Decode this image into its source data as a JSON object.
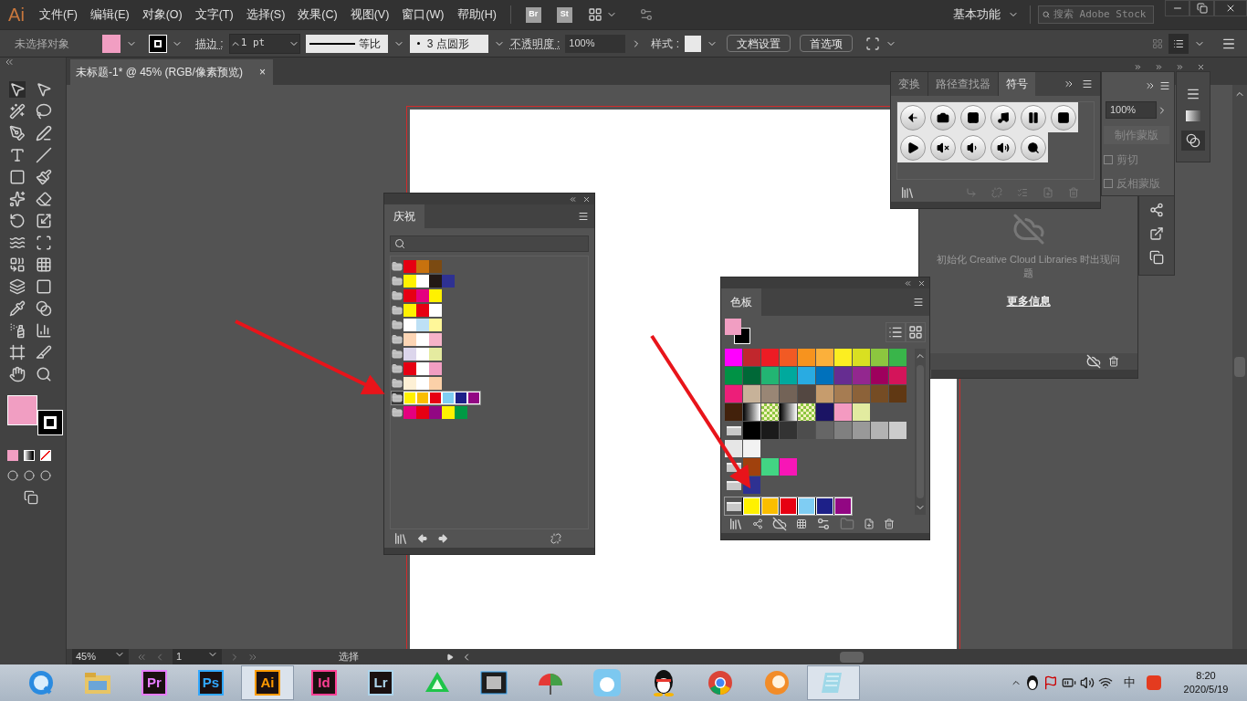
{
  "app": {
    "logo": "Ai",
    "menus": [
      "文件(F)",
      "编辑(E)",
      "对象(O)",
      "文字(T)",
      "选择(S)",
      "效果(C)",
      "视图(V)",
      "窗口(W)",
      "帮助(H)"
    ],
    "bridges": [
      "Br",
      "St"
    ],
    "workspace": "基本功能",
    "search": {
      "placeholder": "搜索 Adobe Stock"
    }
  },
  "control_bar": {
    "selection": "未选择对象",
    "fill": {
      "color": "#f19ec2"
    },
    "stroke_label": "描边 :",
    "stroke_weight": "1 pt",
    "stroke_profile": "等比",
    "brush": "3 点圆形",
    "opacity_label": "不透明度 :",
    "opacity": "100%",
    "style_label": "样式 :",
    "buttons": [
      "文档设置",
      "首选项"
    ]
  },
  "document_tab": {
    "title": "未标题-1* @ 45% (RGB/像素预览)",
    "close": "×"
  },
  "celebration_panel": {
    "tab": "庆祝",
    "groups": [
      {
        "selected": false,
        "colors": [
          {
            "color": "#e60012"
          },
          {
            "color": "#c8720e"
          },
          {
            "color": "#7b4a12"
          }
        ]
      },
      {
        "selected": false,
        "colors": [
          {
            "color": "#fff100"
          },
          {
            "color": "#ffffff"
          },
          {
            "color": "#231815"
          },
          {
            "color": "#2e3192"
          }
        ]
      },
      {
        "selected": false,
        "colors": [
          {
            "color": "#e60012"
          },
          {
            "color": "#e4007f"
          },
          {
            "color": "#fff100"
          }
        ]
      },
      {
        "selected": false,
        "colors": [
          {
            "color": "#fff100"
          },
          {
            "color": "#e60012"
          },
          {
            "color": "#ffffff"
          }
        ]
      },
      {
        "selected": false,
        "colors": [
          {
            "color": "#ffffff"
          },
          {
            "color": "#bde0f5"
          },
          {
            "color": "#fff799"
          }
        ]
      },
      {
        "selected": false,
        "colors": [
          {
            "color": "#fcd5b5"
          },
          {
            "color": "#ffffff"
          },
          {
            "color": "#f6b3c8"
          }
        ]
      },
      {
        "selected": false,
        "colors": [
          {
            "color": "#dcd6ec"
          },
          {
            "color": "#ffffff"
          },
          {
            "color": "#e5eba0"
          }
        ]
      },
      {
        "selected": false,
        "colors": [
          {
            "color": "#e60012"
          },
          {
            "color": "#ffffff"
          },
          {
            "color": "#f19ec2"
          }
        ]
      },
      {
        "selected": false,
        "colors": [
          {
            "color": "#fdf0d5"
          },
          {
            "color": "#ffffff"
          },
          {
            "color": "#fbd0a8"
          }
        ]
      },
      {
        "selected": true,
        "colors": [
          {
            "color": "#fff100"
          },
          {
            "color": "#fabe00"
          },
          {
            "color": "#e60012"
          },
          {
            "color": "#7fcdf3"
          },
          {
            "color": "#1d2088"
          },
          {
            "color": "#920783"
          }
        ]
      },
      {
        "selected": false,
        "colors": [
          {
            "color": "#e4007f"
          },
          {
            "color": "#e60012"
          },
          {
            "color": "#920783"
          },
          {
            "color": "#fff100"
          },
          {
            "color": "#009944"
          }
        ]
      }
    ]
  },
  "swatches_panel": {
    "tab": "色板",
    "rows": [
      {
        "folder": false,
        "selected": false,
        "cells": [
          {
            "kind": "color",
            "color": "#ff00ff"
          },
          {
            "kind": "color",
            "color": "#c1272d"
          },
          {
            "kind": "color",
            "color": "#ed1c24"
          },
          {
            "kind": "color",
            "color": "#f15a24"
          },
          {
            "kind": "color",
            "color": "#f7931e"
          },
          {
            "kind": "color",
            "color": "#fbb03b"
          },
          {
            "kind": "color",
            "color": "#fcee21"
          },
          {
            "kind": "color",
            "color": "#d9e021"
          },
          {
            "kind": "color",
            "color": "#8cc63f"
          },
          {
            "kind": "color",
            "color": "#39b54a"
          }
        ]
      },
      {
        "folder": false,
        "selected": false,
        "cells": [
          {
            "kind": "color",
            "color": "#009245"
          },
          {
            "kind": "color",
            "color": "#006837"
          },
          {
            "kind": "color",
            "color": "#22b573"
          },
          {
            "kind": "color",
            "color": "#00a99d"
          },
          {
            "kind": "color",
            "color": "#29abe2"
          },
          {
            "kind": "color",
            "color": "#0071bc"
          },
          {
            "kind": "color",
            "color": "#662d91"
          },
          {
            "kind": "color",
            "color": "#93278f"
          },
          {
            "kind": "color",
            "color": "#9e005d"
          },
          {
            "kind": "color",
            "color": "#d4145a"
          }
        ]
      },
      {
        "folder": false,
        "selected": false,
        "cells": [
          {
            "kind": "color",
            "color": "#ed1e79"
          },
          {
            "kind": "color",
            "color": "#c7b299"
          },
          {
            "kind": "color",
            "color": "#998675"
          },
          {
            "kind": "color",
            "color": "#736357"
          },
          {
            "kind": "color",
            "color": "#534741"
          },
          {
            "kind": "color",
            "color": "#c69c6d"
          },
          {
            "kind": "color",
            "color": "#a67c52"
          },
          {
            "kind": "color",
            "color": "#8c6239"
          },
          {
            "kind": "color",
            "color": "#754c24"
          },
          {
            "kind": "color",
            "color": "#603813"
          }
        ]
      },
      {
        "folder": false,
        "selected": false,
        "cells": [
          {
            "kind": "color",
            "color": "#42210b"
          },
          {
            "kind": "gradient"
          },
          {
            "kind": "pattern"
          },
          {
            "kind": "gradient"
          },
          {
            "kind": "pattern"
          },
          {
            "kind": "color",
            "color": "#1b1464"
          },
          {
            "kind": "color",
            "color": "#f49ac1"
          },
          {
            "kind": "color",
            "color": "#e2eba0"
          }
        ]
      },
      {
        "folder": true,
        "selected": false,
        "cells": [
          {
            "kind": "color",
            "color": "#000000"
          },
          {
            "kind": "color",
            "color": "#1a1a1a"
          },
          {
            "kind": "color",
            "color": "#333333"
          },
          {
            "kind": "color",
            "color": "#4d4d4d"
          },
          {
            "kind": "color",
            "color": "#666666"
          },
          {
            "kind": "color",
            "color": "#808080"
          },
          {
            "kind": "color",
            "color": "#999999"
          },
          {
            "kind": "color",
            "color": "#b3b3b3"
          },
          {
            "kind": "color",
            "color": "#cccccc"
          }
        ]
      },
      {
        "folder": false,
        "selected": false,
        "cells": [
          {
            "kind": "color",
            "color": "#e6e6e6"
          },
          {
            "kind": "color",
            "color": "#f2f2f2"
          }
        ]
      },
      {
        "folder": true,
        "selected": false,
        "cells": [
          {
            "kind": "color",
            "color": "#a0410d"
          },
          {
            "kind": "color",
            "color": "#42d483"
          },
          {
            "kind": "color",
            "color": "#f716b6"
          }
        ]
      },
      {
        "folder": true,
        "selected": false,
        "cells": [
          {
            "kind": "color",
            "color": "#2e3192"
          }
        ]
      },
      {
        "folder": true,
        "selected": true,
        "cells": [
          {
            "kind": "color",
            "color": "#fff100"
          },
          {
            "kind": "color",
            "color": "#fabe00"
          },
          {
            "kind": "color",
            "color": "#e60012"
          },
          {
            "kind": "color",
            "color": "#7fcdf3"
          },
          {
            "kind": "color",
            "color": "#1d2088"
          },
          {
            "kind": "color",
            "color": "#920783"
          }
        ]
      }
    ]
  },
  "symbols_panel": {
    "tabs": [
      {
        "label": "变换",
        "selected": false
      },
      {
        "label": "路径查找器",
        "selected": false
      },
      {
        "label": "符号",
        "selected": true
      }
    ]
  },
  "transparency_panel": {
    "opacity": "100%",
    "make_mask": {
      "label": "制作蒙版",
      "disabled": true
    },
    "options": [
      {
        "label": "剪切",
        "checked": false
      },
      {
        "label": "反相蒙版",
        "checked": false
      }
    ]
  },
  "libraries_panel": {
    "message": "初始化 Creative Cloud Libraries 时出现问题",
    "link": "更多信息"
  },
  "status_bar": {
    "zoom": "45%",
    "page": "1",
    "tool": "选择"
  },
  "taskbar": {
    "apps": [
      {
        "kind": "browser",
        "active": false
      },
      {
        "kind": "explorer",
        "active": false
      },
      {
        "kind": "adobe",
        "label": "Pr",
        "color": "#e77cff",
        "active": false
      },
      {
        "kind": "adobe",
        "label": "Ps",
        "color": "#31a8ff",
        "active": false
      },
      {
        "kind": "adobe",
        "label": "Ai",
        "color": "#ff9a00",
        "active": true
      },
      {
        "kind": "adobe",
        "label": "Id",
        "color": "#ff3f94",
        "active": false
      },
      {
        "kind": "adobe",
        "label": "Lr",
        "color": "#add5ec",
        "active": false
      },
      {
        "kind": "cloud",
        "active": false
      },
      {
        "kind": "video",
        "active": false
      },
      {
        "kind": "umbrella",
        "active": false
      },
      {
        "kind": "bird",
        "active": false
      },
      {
        "kind": "penguin",
        "active": false
      },
      {
        "kind": "chrome",
        "active": false
      },
      {
        "kind": "fox",
        "active": false
      },
      {
        "kind": "notepad",
        "active": true
      }
    ],
    "ime": "中",
    "time": "8:20",
    "date": "2020/5/19"
  }
}
